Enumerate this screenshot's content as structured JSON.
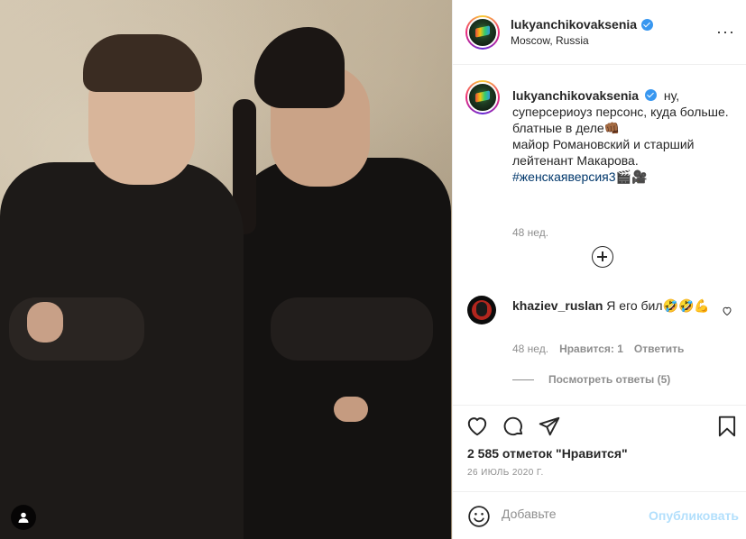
{
  "post": {
    "username": "lukyanchikovaksenia",
    "location": "Moscow, Russia",
    "more_label": "···"
  },
  "caption": {
    "username": "lukyanchikovaksenia",
    "line1": "ну, суперсериоуз персонс, куда больше.",
    "line2": "блатные в деле👊🏾",
    "line3": "майор Романовский и старший лейтенант Макарова.",
    "hashtag": "#женскаяверсия3🎬🎥",
    "time": "48 нед."
  },
  "comment": {
    "username": "khaziev_ruslan",
    "text": "Я его бил🤣🤣💪",
    "time": "48 нед.",
    "likes": "Нравится: 1",
    "reply": "Ответить",
    "view_replies": "Посмотреть ответы (5)"
  },
  "actions": {
    "likes_count": "2 585 отметок \"Нравится\"",
    "date": "26 ИЮЛЬ 2020 Г."
  },
  "add_comment": {
    "placeholder": "Добавьте",
    "post_label": "Опубликовать"
  },
  "icons": {
    "like": "heart-icon",
    "comment": "comment-icon",
    "share": "share-icon",
    "save": "bookmark-icon",
    "emoji": "emoji-icon",
    "tag": "user-tag-icon"
  },
  "colors": {
    "link_blue": "#00376b",
    "verified_blue": "#3897f0",
    "post_button_disabled": "#b2dffc",
    "secondary_text": "#8e8e8e"
  }
}
